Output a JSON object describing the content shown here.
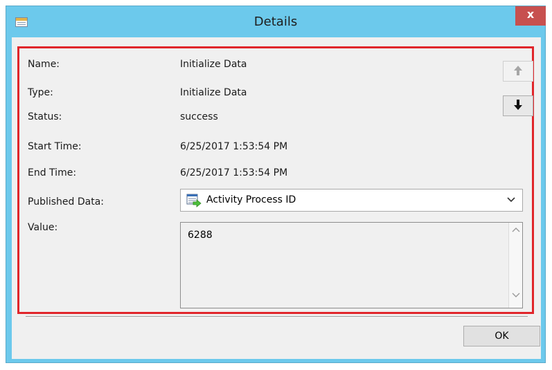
{
  "window": {
    "title": "Details",
    "close_label": "x"
  },
  "fields": {
    "name": {
      "label": "Name:",
      "value": "Initialize Data"
    },
    "type": {
      "label": "Type:",
      "value": "Initialize Data"
    },
    "status": {
      "label": "Status:",
      "value": "success"
    },
    "start_time": {
      "label": "Start Time:",
      "value": "6/25/2017 1:53:54 PM"
    },
    "end_time": {
      "label": "End Time:",
      "value": "6/25/2017 1:53:54 PM"
    },
    "published_data": {
      "label": "Published Data:",
      "selected": "Activity Process ID",
      "icon": "published-data-icon"
    },
    "value": {
      "label": "Value:",
      "text": "6288"
    }
  },
  "nav": {
    "up_icon": "arrow-up-icon",
    "up_enabled": false,
    "down_icon": "arrow-down-icon",
    "down_enabled": true
  },
  "buttons": {
    "ok_label": "OK"
  },
  "colors": {
    "titlebar": "#6cc9ec",
    "close": "#c7504f",
    "highlight_frame": "#e0262b"
  }
}
